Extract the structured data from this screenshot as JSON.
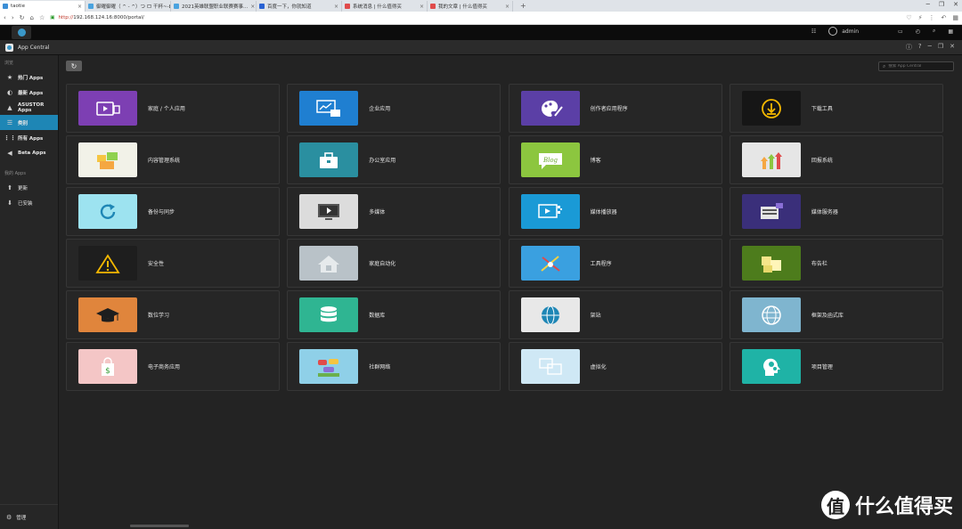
{
  "browser": {
    "tabs": [
      {
        "label": "taotie",
        "fav": "#3c8fd6"
      },
      {
        "label": "御曜御曜（ ^ - ^）つ ロ 干杯~-bilibili",
        "fav": "#4aa3df"
      },
      {
        "label": "2021英雄联盟职业联赛赛事...",
        "fav": "#4aa3df"
      },
      {
        "label": "百度一下，你就知道",
        "fav": "#2a62d3"
      },
      {
        "label": "系统消息 | 什么值得买",
        "fav": "#e04b4b"
      },
      {
        "label": "我的文章 | 什么值得买",
        "fav": "#e04b4b"
      }
    ],
    "new_tab": "+",
    "url_prefix": "http://",
    "url": "192.168.124.16:8000/portal/",
    "zoom_icon": "↶"
  },
  "adm": {
    "user": "admin"
  },
  "window": {
    "title": "App Central"
  },
  "sidebar": {
    "browse_label": "浏览",
    "browse_items": [
      {
        "label": "热门 Apps",
        "icon": "★"
      },
      {
        "label": "最新 Apps",
        "icon": "◐"
      },
      {
        "label": "ASUSTOR Apps",
        "icon": "▲"
      },
      {
        "label": "类别",
        "icon": "☰"
      },
      {
        "label": "所有 Apps",
        "icon": "⋮⋮"
      },
      {
        "label": "Beta Apps",
        "icon": "◀"
      }
    ],
    "myapps_label": "我的 Apps",
    "myapps_items": [
      {
        "label": "更新",
        "icon": "⬆"
      },
      {
        "label": "已安装",
        "icon": "⬇"
      }
    ],
    "manage_label": "管理"
  },
  "main": {
    "refresh_icon": "↻",
    "search_placeholder": "搜索 App Central",
    "categories": [
      {
        "label": "家庭 / 个人应用",
        "icon": "film-icon",
        "bg": "#7d3fb3"
      },
      {
        "label": "企业应用",
        "icon": "chart-briefcase-icon",
        "bg": "#1f7fd1"
      },
      {
        "label": "创作者应用程序",
        "icon": "palette-icon",
        "bg": "#5b3fa6"
      },
      {
        "label": "下载工具",
        "icon": "download-icon",
        "bg": "#161616"
      },
      {
        "label": "内容管理系统",
        "icon": "folders-icon",
        "bg": "#f2f2e8"
      },
      {
        "label": "办公室应用",
        "icon": "briefcase-icon",
        "bg": "#2a8fa0"
      },
      {
        "label": "博客",
        "icon": "blog-icon",
        "bg": "#8cc63f"
      },
      {
        "label": "回报系统",
        "icon": "arrows-icon",
        "bg": "#e6e6e6"
      },
      {
        "label": "备份与同步",
        "icon": "sync-icon",
        "bg": "#9de3f0"
      },
      {
        "label": "多媒体",
        "icon": "monitor-play-icon",
        "bg": "#dcdcdc"
      },
      {
        "label": "媒体播放器",
        "icon": "video-screen-icon",
        "bg": "#1a9ad6"
      },
      {
        "label": "媒体服务器",
        "icon": "server-media-icon",
        "bg": "#3a2f7a"
      },
      {
        "label": "安全性",
        "icon": "warning-icon",
        "bg": "#1e1e1e"
      },
      {
        "label": "家庭自动化",
        "icon": "home-icon",
        "bg": "#b9c2c8"
      },
      {
        "label": "工具程序",
        "icon": "tools-icon",
        "bg": "#3aa0e0"
      },
      {
        "label": "布告栏",
        "icon": "notes-icon",
        "bg": "#4d7c1c"
      },
      {
        "label": "数位学习",
        "icon": "graduation-cap-icon",
        "bg": "#e0853c"
      },
      {
        "label": "数据库",
        "icon": "database-icon",
        "bg": "#2fb592"
      },
      {
        "label": "架站",
        "icon": "globe-icon",
        "bg": "#e8e8e8"
      },
      {
        "label": "框架及函式库",
        "icon": "sphere-icon",
        "bg": "#7fb5cf"
      },
      {
        "label": "电子商务应用",
        "icon": "shopping-bag-icon",
        "bg": "#f4c6c6"
      },
      {
        "label": "社群网络",
        "icon": "chat-bubbles-icon",
        "bg": "#8fd0e8"
      },
      {
        "label": "虚拟化",
        "icon": "virtual-screens-icon",
        "bg": "#cfe8f5"
      },
      {
        "label": "项目管理",
        "icon": "head-gears-icon",
        "bg": "#1fb3a6"
      }
    ]
  },
  "watermark": {
    "logo_char": "值",
    "text": "什么值得买"
  }
}
